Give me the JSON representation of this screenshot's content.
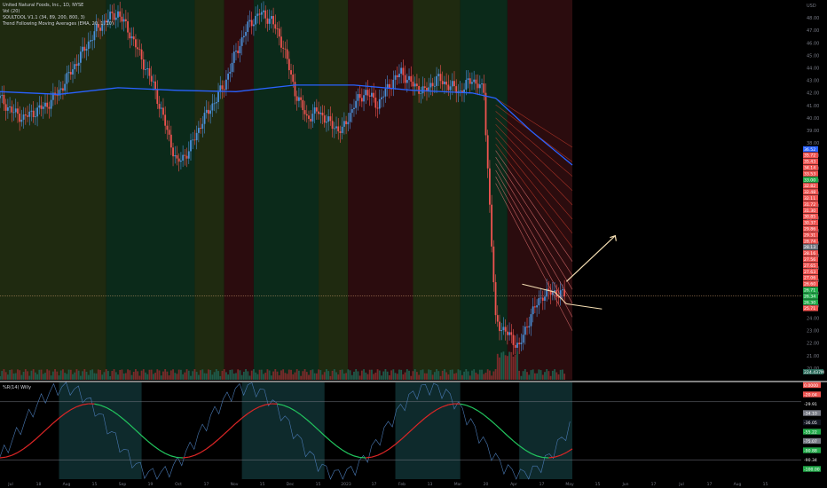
{
  "legend": {
    "symbol": "United Natural Foods, Inc., 1D, NYSE",
    "vol": "Vol (20)",
    "soultool": "SOULTOOL V1.1 (34, 89, 200, 800, 3)",
    "tfma": "Trend Following Moving Averages (EMA, 20, 1, 10)"
  },
  "indicator_legend": "%R(14) Willy",
  "colors": {
    "background": "#000000",
    "zone_green": "#0b2a1a",
    "zone_red": "#2b0c0e",
    "zone_olive": "#1f2a10",
    "zone_teal": "#0e2a2c",
    "bull": "#26a69a",
    "bear": "#ef5350",
    "sma": "#2962ff",
    "arrow": "#f5deb3"
  },
  "chart_data": {
    "type": "candlestick",
    "title": "United Natural Foods, Inc., 1D, NYSE",
    "currency": "USD",
    "x_ticks": [
      "Jul",
      "18",
      "Aug",
      "15",
      "Sep",
      "19",
      "Oct",
      "17",
      "Nov",
      "15",
      "Dec",
      "15",
      "2023",
      "17",
      "Feb",
      "13",
      "Mar",
      "20",
      "Apr",
      "17",
      "May",
      "15",
      "Jun",
      "17",
      "Jul",
      "17",
      "Aug",
      "15"
    ],
    "y_ticks": [
      "USD",
      "48.00",
      "47.00",
      "46.00",
      "45.00",
      "44.00",
      "43.00",
      "42.00",
      "41.00",
      "40.00",
      "39.00",
      "38.00",
      "37.00",
      "36.00",
      "35.00",
      "34.00",
      "33.00",
      "32.00",
      "31.00",
      "30.00",
      "29.00",
      "28.00",
      "27.00",
      "26.00",
      "25.00",
      "24.00",
      "23.00",
      "22.00",
      "21.00",
      "20.00"
    ],
    "price_labels": [
      {
        "text": "36.52",
        "color": "#2962ff"
      },
      {
        "text": "35.72",
        "color": "#ef5350"
      },
      {
        "text": "35.43",
        "color": "#ef5350"
      },
      {
        "text": "34.14",
        "color": "#ef5350"
      },
      {
        "text": "33.53",
        "color": "#ef5350"
      },
      {
        "text": "33.00",
        "color": "#22ab4a"
      },
      {
        "text": "32.82",
        "color": "#ef5350"
      },
      {
        "text": "32.48",
        "color": "#ef5350"
      },
      {
        "text": "32.11",
        "color": "#ef5350"
      },
      {
        "text": "31.72",
        "color": "#ef5350"
      },
      {
        "text": "31.30",
        "color": "#ef5350"
      },
      {
        "text": "30.85",
        "color": "#ef5350"
      },
      {
        "text": "30.37",
        "color": "#ef5350"
      },
      {
        "text": "29.86",
        "color": "#ef5350"
      },
      {
        "text": "29.31",
        "color": "#ef5350"
      },
      {
        "text": "28.74",
        "color": "#ef5350"
      },
      {
        "text": "28.13",
        "color": "#787b86"
      },
      {
        "text": "28.16",
        "color": "#ef5350"
      },
      {
        "text": "27.56",
        "color": "#ef5350"
      },
      {
        "text": "27.65",
        "color": "#ef5350"
      },
      {
        "text": "27.63",
        "color": "#ef5350"
      },
      {
        "text": "27.06",
        "color": "#ef5350"
      },
      {
        "text": "26.60",
        "color": "#ef5350"
      },
      {
        "text": "26.71",
        "color": "#22ab4a"
      },
      {
        "text": "26.34",
        "color": "#22ab4a"
      },
      {
        "text": "26.30",
        "color": "#22ab4a"
      },
      {
        "text": "25.71",
        "color": "#ef5350"
      }
    ],
    "volume_label": "224.437M",
    "zones": [
      {
        "from": 0,
        "to": 18,
        "color": "olive"
      },
      {
        "from": 18,
        "to": 33,
        "color": "green"
      },
      {
        "from": 33,
        "to": 38,
        "color": "olive"
      },
      {
        "from": 38,
        "to": 43,
        "color": "red"
      },
      {
        "from": 43,
        "to": 54,
        "color": "green"
      },
      {
        "from": 54,
        "to": 59,
        "color": "olive"
      },
      {
        "from": 59,
        "to": 70,
        "color": "red"
      },
      {
        "from": 70,
        "to": 78,
        "color": "olive"
      },
      {
        "from": 78,
        "to": 86,
        "color": "green"
      },
      {
        "from": 86,
        "to": 97,
        "color": "red"
      }
    ],
    "series": [
      {
        "name": "Close",
        "x": [
          0,
          2,
          4,
          6,
          8,
          10,
          12,
          14,
          16,
          18,
          20,
          22,
          24,
          26,
          28,
          30,
          32,
          34,
          36,
          38,
          40,
          42,
          44,
          46,
          48,
          50,
          52,
          54,
          56,
          58,
          60,
          62,
          64,
          66,
          68,
          70,
          72,
          74,
          76,
          78,
          80,
          82,
          84,
          86,
          88,
          90,
          92,
          94,
          96
        ],
        "values": [
          41.0,
          40.0,
          39.5,
          40.0,
          40.5,
          41.5,
          43.0,
          44.5,
          46.0,
          47.0,
          47.5,
          46.0,
          44.0,
          42.0,
          39.0,
          36.0,
          37.0,
          39.0,
          40.5,
          42.0,
          44.5,
          46.5,
          47.5,
          47.0,
          45.0,
          41.5,
          39.5,
          40.0,
          39.0,
          38.5,
          40.5,
          41.5,
          40.5,
          42.0,
          43.0,
          42.0,
          41.5,
          42.5,
          42.0,
          41.5,
          42.5,
          41.5,
          24.0,
          23.0,
          22.0,
          24.5,
          26.0,
          26.2,
          25.9
        ]
      },
      {
        "name": "Trend MA",
        "x": [
          0,
          10,
          20,
          30,
          40,
          50,
          60,
          70,
          80,
          84,
          90,
          97
        ],
        "values": [
          41.5,
          41.3,
          41.8,
          41.6,
          41.5,
          42.0,
          42.0,
          41.6,
          41.4,
          41.0,
          38.5,
          35.9
        ]
      }
    ],
    "projection": {
      "from": [
        96,
        27.0
      ],
      "to": [
        104,
        30.5
      ]
    },
    "indicator": {
      "name": "%R(14) Willy",
      "labels": [
        {
          "text": "0.0000",
          "color": "#ef5350"
        },
        {
          "text": "-20.04",
          "color": "#ef5350"
        },
        {
          "text": "-29.91",
          "color": "#000000"
        },
        {
          "text": "-34.10",
          "color": "#787b86"
        },
        {
          "text": "-36.05",
          "color": "#131722"
        },
        {
          "text": "-55.22",
          "color": "#22ab4a"
        },
        {
          "text": "-75.07",
          "color": "#787b86"
        },
        {
          "text": "-90.88",
          "color": "#22ab4a"
        },
        {
          "text": "-90.34",
          "color": "#000000"
        },
        {
          "text": "-100.00",
          "color": "#22ab4a"
        }
      ],
      "zones": [
        {
          "from": 10,
          "to": 24
        },
        {
          "from": 41,
          "to": 55
        },
        {
          "from": 67,
          "to": 78
        },
        {
          "from": 88,
          "to": 97
        }
      ]
    }
  }
}
